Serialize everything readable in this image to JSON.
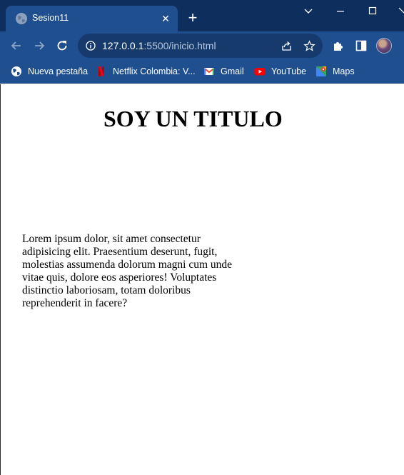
{
  "browser": {
    "tab": {
      "title": "Sesion11",
      "favicon": "globe-icon"
    },
    "window_controls": [
      "tab-search-icon",
      "minimize-icon",
      "maximize-icon",
      "close-icon"
    ],
    "address": {
      "host": "127.0.0.1",
      "path": ":5500/inicio.html"
    },
    "toolbar_icons": [
      "back-icon",
      "forward-icon",
      "reload-icon",
      "info-icon",
      "share-icon",
      "star-icon",
      "extensions-icon",
      "side-panel-icon",
      "avatar"
    ],
    "bookmarks": [
      {
        "label": "Nueva pestaña",
        "icon": "globe-icon"
      },
      {
        "label": "Netflix Colombia: V...",
        "icon": "netflix-icon"
      },
      {
        "label": "Gmail",
        "icon": "gmail-icon"
      },
      {
        "label": "YouTube",
        "icon": "youtube-icon"
      },
      {
        "label": "Maps",
        "icon": "maps-icon"
      }
    ],
    "colors": {
      "frame": "#0e2f5e",
      "toolbar": "#1f4f8f",
      "omnibox": "#163a6b"
    }
  },
  "page": {
    "title": "SOY UN TITULO",
    "paragraph": "Lorem ipsum dolor, sit amet consectetur adipisicing elit. Praesentium deserunt, fugit, molestias assumenda dolorum magni cum unde vitae quis, dolore eos asperiores! Voluptates distinctio laboriosam, totam doloribus reprehenderit in facere?"
  }
}
